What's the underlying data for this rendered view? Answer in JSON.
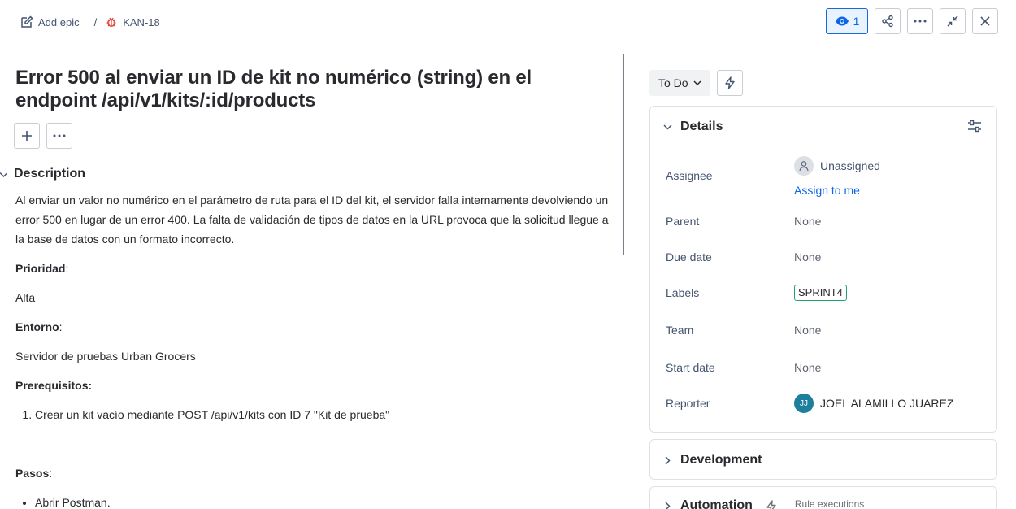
{
  "header": {
    "add_epic_label": "Add epic",
    "separator": "/",
    "issue_key": "KAN-18",
    "watch_count": "1",
    "icons": [
      "pencil-icon",
      "bug-icon",
      "eye-icon",
      "share-icon",
      "more-icon",
      "minimize-icon",
      "close-icon"
    ]
  },
  "issue": {
    "title": "Error 500 al enviar un ID de kit no numérico (string) en el endpoint /api/v1/kits/:id/products",
    "description_heading": "Description",
    "description_text": "Al enviar un valor no numérico en el parámetro de ruta para el ID del kit, el servidor falla internamente devolviendo un error 500 en lugar de un error 400. La falta de validación de tipos de datos en la URL provoca que la solicitud llegue a la base de datos con un formato incorrecto.",
    "priority_label": "Prioridad",
    "priority_value": "Alta",
    "environment_label": "Entorno",
    "environment_value": "Servidor de pruebas Urban Grocers",
    "prereq_label": "Prerequisitos:",
    "prereq_items": [
      "Crear un kit vacío mediante POST /api/v1/kits con ID 7 \"Kit de prueba\""
    ],
    "steps_label": "Pasos",
    "steps_items": [
      "Abrir Postman."
    ]
  },
  "status": {
    "current": "To Do"
  },
  "details": {
    "heading": "Details",
    "fields": {
      "assignee_label": "Assignee",
      "assignee_value": "Unassigned",
      "assign_to_me": "Assign to me",
      "parent_label": "Parent",
      "parent_value": "None",
      "due_label": "Due date",
      "due_value": "None",
      "labels_label": "Labels",
      "labels_value": "SPRINT4",
      "team_label": "Team",
      "team_value": "None",
      "start_label": "Start date",
      "start_value": "None",
      "reporter_label": "Reporter",
      "reporter_value": "JOEL ALAMILLO JUAREZ",
      "reporter_initials": "JJ"
    }
  },
  "development": {
    "heading": "Development"
  },
  "automation": {
    "heading": "Automation",
    "rule_executions": "Rule executions"
  },
  "colors": {
    "accent": "#0c66e4",
    "label_border": "#22a06b",
    "reporter_avatar": "#1d7f9b",
    "bug": "#e2483d"
  }
}
